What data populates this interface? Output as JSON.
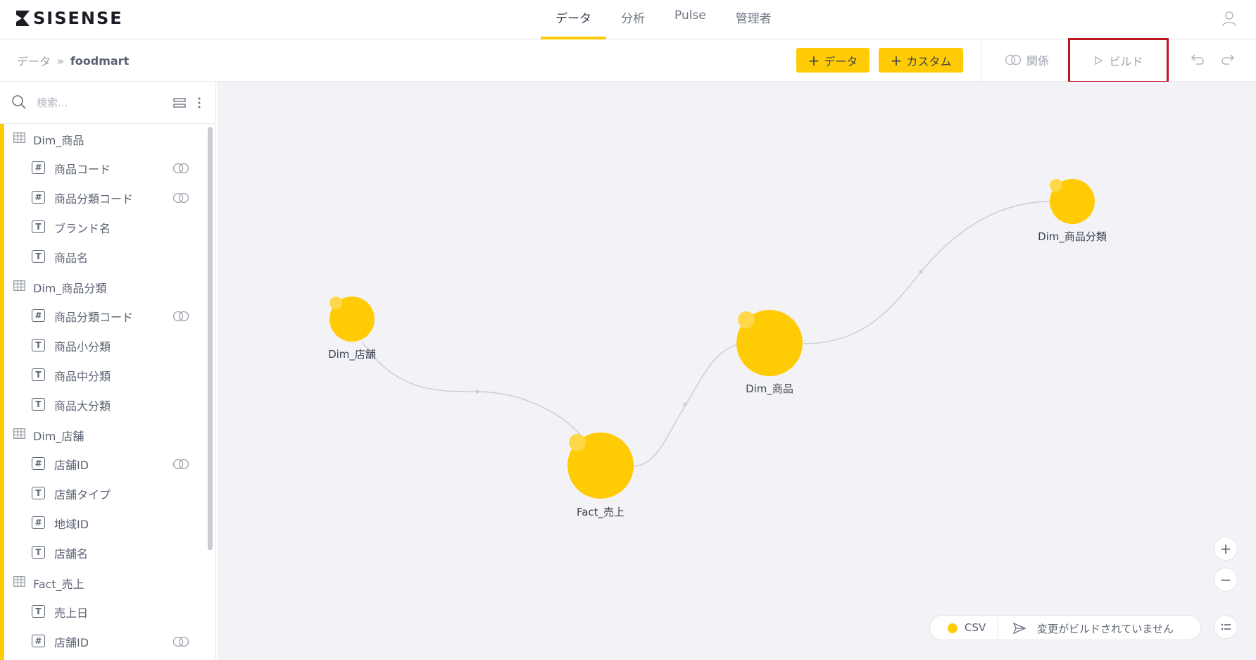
{
  "app": {
    "logo_text": "SISENSE"
  },
  "nav": {
    "tabs": [
      {
        "label": "データ",
        "active": true
      },
      {
        "label": "分析",
        "active": false
      },
      {
        "label": "Pulse",
        "active": false
      },
      {
        "label": "管理者",
        "active": false
      }
    ]
  },
  "breadcrumb": {
    "root": "データ",
    "separator": "»",
    "current": "foodmart"
  },
  "toolbar": {
    "add_data_label": "データ",
    "add_custom_label": "カスタム",
    "relations_label": "関係",
    "build_label": "ビルド"
  },
  "sidebar": {
    "search_placeholder": "検索...",
    "tables": [
      {
        "name": "Dim_商品",
        "fields": [
          {
            "type": "#",
            "label": "商品コード",
            "linked": true
          },
          {
            "type": "#",
            "label": "商品分類コード",
            "linked": true
          },
          {
            "type": "T",
            "label": "ブランド名",
            "linked": false
          },
          {
            "type": "T",
            "label": "商品名",
            "linked": false
          }
        ]
      },
      {
        "name": "Dim_商品分類",
        "fields": [
          {
            "type": "#",
            "label": "商品分類コード",
            "linked": true
          },
          {
            "type": "T",
            "label": "商品小分類",
            "linked": false
          },
          {
            "type": "T",
            "label": "商品中分類",
            "linked": false
          },
          {
            "type": "T",
            "label": "商品大分類",
            "linked": false
          }
        ]
      },
      {
        "name": "Dim_店舗",
        "fields": [
          {
            "type": "#",
            "label": "店舗ID",
            "linked": true
          },
          {
            "type": "T",
            "label": "店舗タイプ",
            "linked": false
          },
          {
            "type": "#",
            "label": "地域ID",
            "linked": false
          },
          {
            "type": "T",
            "label": "店舗名",
            "linked": false
          }
        ]
      },
      {
        "name": "Fact_売上",
        "fields": [
          {
            "type": "T",
            "label": "売上日",
            "linked": false
          },
          {
            "type": "#",
            "label": "店舗ID",
            "linked": true
          }
        ]
      }
    ]
  },
  "canvas": {
    "nodes": [
      {
        "id": "dim_shohin_bunrui",
        "label": "Dim_商品分類"
      },
      {
        "id": "dim_tenpo",
        "label": "Dim_店舗"
      },
      {
        "id": "dim_shohin",
        "label": "Dim_商品"
      },
      {
        "id": "fact_uriage",
        "label": "Fact_売上"
      }
    ],
    "legend": {
      "type_label": "CSV",
      "status_text": "変更がビルドされていません"
    }
  },
  "colors": {
    "accent": "#ffcb05",
    "highlight_border": "#c0141f",
    "canvas_bg": "#f3f3f7"
  }
}
